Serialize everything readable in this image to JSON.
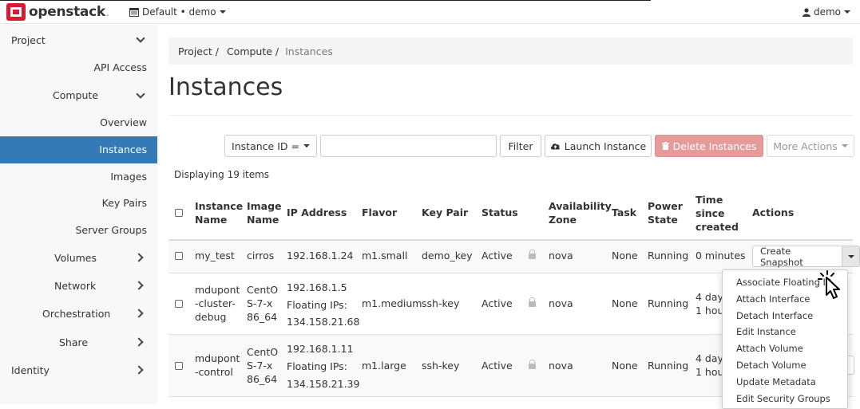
{
  "topbar": {
    "brand": "openstack",
    "brand_dot": ".",
    "project_switcher": "Default • demo",
    "user": "demo"
  },
  "sidebar": {
    "project": "Project",
    "api_access": "API Access",
    "compute": "Compute",
    "overview": "Overview",
    "instances": "Instances",
    "images": "Images",
    "key_pairs": "Key Pairs",
    "server_groups": "Server Groups",
    "volumes": "Volumes",
    "network": "Network",
    "orchestration": "Orchestration",
    "share": "Share",
    "identity": "Identity"
  },
  "breadcrumb": [
    "Project /",
    "Compute /",
    "Instances"
  ],
  "page_title": "Instances",
  "toolbar": {
    "filter_field": "Instance ID =",
    "filter_value": "",
    "filter_button": "Filter",
    "launch_button": "Launch Instance",
    "delete_button": "Delete Instances",
    "more_actions": "More Actions"
  },
  "item_count": "Displaying 19 items",
  "table": {
    "headers": {
      "name": [
        "Instance",
        "Name"
      ],
      "image": [
        "Image",
        "Name"
      ],
      "ip": "IP Address",
      "flavor": "Flavor",
      "keypair": "Key Pair",
      "status": "Status",
      "az": [
        "Availability",
        "Zone"
      ],
      "task": "Task",
      "power": [
        "Power",
        "State"
      ],
      "time": [
        "Time",
        "since",
        "created"
      ],
      "actions": "Actions"
    },
    "rows": [
      {
        "name": [
          "my_test"
        ],
        "image": [
          "cirros"
        ],
        "ip": [
          "192.168.1.24"
        ],
        "flavor": "m1.small",
        "keypair": "demo_key",
        "status": "Active",
        "az": "nova",
        "task": "None",
        "power": "Running",
        "time": [
          "0 minutes"
        ],
        "action": "Create Snapshot"
      },
      {
        "name": [
          "mdupont",
          "-cluster-",
          "debug"
        ],
        "image": [
          "CentO",
          "S-7-x",
          "86_64"
        ],
        "ip": [
          "192.168.1.5",
          "Floating IPs:",
          "134.158.21.68"
        ],
        "flavor": "m1.medium",
        "keypair": "ssh-key",
        "status": "Active",
        "az": "nova",
        "task": "None",
        "power": "Running",
        "time": [
          "4 day",
          "1 hou"
        ]
      },
      {
        "name": [
          "mdupont",
          "-control"
        ],
        "image": [
          "CentO",
          "S-7-x",
          "86_64"
        ],
        "ip": [
          "192.168.1.11",
          "Floating IPs:",
          "134.158.21.39"
        ],
        "flavor": "m1.large",
        "keypair": "ssh-key",
        "status": "Active",
        "az": "nova",
        "task": "None",
        "power": "Running",
        "time": [
          "4 day",
          "1 hou"
        ]
      }
    ]
  },
  "actions_menu": [
    "Associate Floating IP",
    "Attach Interface",
    "Detach Interface",
    "Edit Instance",
    "Attach Volume",
    "Detach Volume",
    "Update Metadata",
    "Edit Security Groups"
  ],
  "colors": {
    "accent": "#337ab7",
    "danger_button": "#e49c9a",
    "brand_red": "#da1a32",
    "sidebar_bg": "#f8f8f8"
  }
}
